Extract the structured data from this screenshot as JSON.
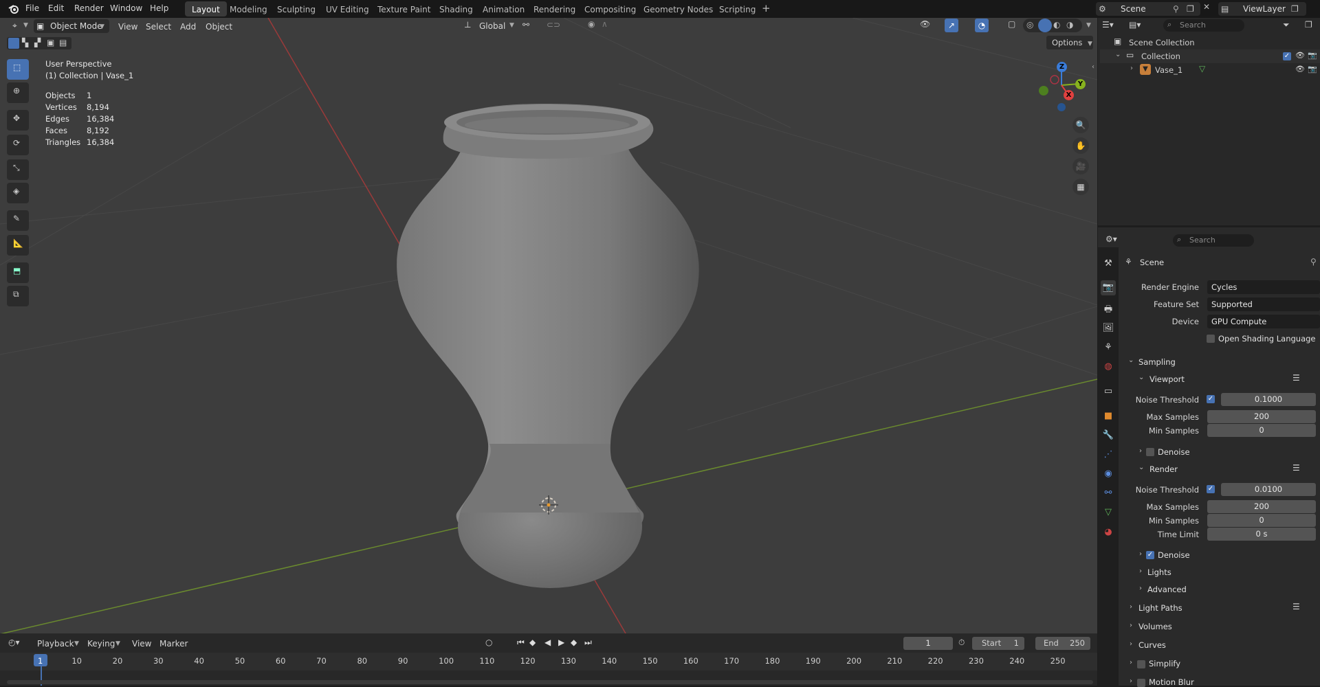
{
  "menubar": {
    "items": [
      "File",
      "Edit",
      "Render",
      "Window",
      "Help"
    ],
    "workspaces": [
      "Layout",
      "Modeling",
      "Sculpting",
      "UV Editing",
      "Texture Paint",
      "Shading",
      "Animation",
      "Rendering",
      "Compositing",
      "Geometry Nodes",
      "Scripting"
    ],
    "active_workspace": "Layout",
    "add_tab": "+",
    "scene_name": "Scene",
    "view_layer": "ViewLayer"
  },
  "viewport_header": {
    "mode": "Object Mode",
    "menus": [
      "View",
      "Select",
      "Add",
      "Object"
    ],
    "transform_orientation": "Global",
    "options_label": "Options"
  },
  "overlay": {
    "perspective": "User Perspective",
    "collection_label": "(1) Collection | Vase_1",
    "stats": [
      {
        "label": "Objects",
        "value": "1"
      },
      {
        "label": "Vertices",
        "value": "8,194"
      },
      {
        "label": "Edges",
        "value": "16,384"
      },
      {
        "label": "Faces",
        "value": "8,192"
      },
      {
        "label": "Triangles",
        "value": "16,384"
      }
    ]
  },
  "gizmo": {
    "z": "Z",
    "y": "Y",
    "x": "X"
  },
  "colors": {
    "accent": "#4772b3",
    "x_axis": "#e0403f",
    "y_axis": "#87b21e",
    "z_axis": "#3a7cd9"
  },
  "outliner": {
    "search_placeholder": "Search",
    "scene_collection": "Scene Collection",
    "collection": "Collection",
    "object": "Vase_1"
  },
  "properties": {
    "search_placeholder": "Search",
    "context": "Scene",
    "render_engine_label": "Render Engine",
    "render_engine": "Cycles",
    "feature_set_label": "Feature Set",
    "feature_set": "Supported",
    "device_label": "Device",
    "device": "GPU Compute",
    "osl_label": "Open Shading Language",
    "sampling": "Sampling",
    "viewport": "Viewport",
    "noise_threshold_label": "Noise Threshold",
    "vp_noise_threshold": "0.1000",
    "max_samples_label": "Max Samples",
    "vp_max_samples": "200",
    "min_samples_label": "Min Samples",
    "vp_min_samples": "0",
    "denoise_label": "Denoise",
    "render": "Render",
    "r_noise_threshold": "0.0100",
    "r_max_samples": "200",
    "r_min_samples": "0",
    "time_limit_label": "Time Limit",
    "r_time_limit": "0 s",
    "lights": "Lights",
    "advanced": "Advanced",
    "light_paths": "Light Paths",
    "volumes": "Volumes",
    "curves": "Curves",
    "simplify": "Simplify",
    "motion_blur": "Motion Blur"
  },
  "timeline": {
    "menus": [
      "Playback",
      "Keying",
      "View",
      "Marker"
    ],
    "current_frame": "1",
    "start_label": "Start",
    "start": "1",
    "end_label": "End",
    "end": "250",
    "ticks": [
      "1",
      "10",
      "20",
      "30",
      "40",
      "50",
      "60",
      "70",
      "80",
      "90",
      "100",
      "110",
      "120",
      "130",
      "140",
      "150",
      "160",
      "170",
      "180",
      "190",
      "200",
      "210",
      "220",
      "230",
      "240",
      "250"
    ]
  }
}
